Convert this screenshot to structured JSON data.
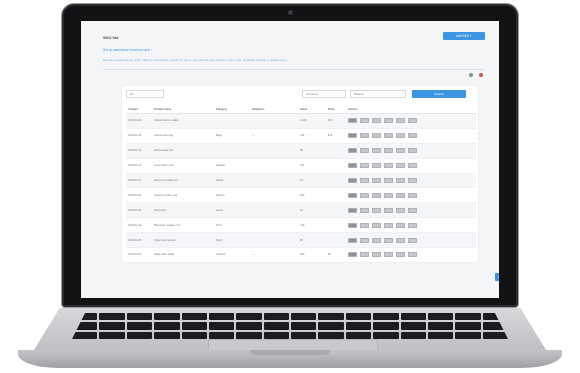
{
  "app": {
    "title": "SKU list",
    "primary_button": "Add SKU +",
    "link_text": "Set up warehouse inventory sync ›",
    "description": "Manage stock-keeping units. Filter by warehouse, search by name, and use the row actions to view, edit, duplicate, archive or delete items.",
    "icons": [
      "settings-icon",
      "alert-icon"
    ],
    "filters": {
      "per_page": "10",
      "status": "All status",
      "search_placeholder": "Search",
      "button": "Search"
    },
    "table": {
      "headers": [
        "Created",
        "Product name",
        "Category",
        "Variations",
        "Stock",
        "Price",
        "Actions"
      ],
      "rows": [
        [
          "2019-01-02",
          "Classic leather wallet",
          "",
          "",
          "1,204",
          "€12",
          ""
        ],
        [
          "2019-01-08",
          "Canvas tote bag",
          "Bags",
          "—",
          "312",
          "€15",
          ""
        ],
        [
          "2019-01-12",
          "Wool beanie hat",
          "",
          "",
          "98",
          "",
          ""
        ],
        [
          "2019-01-20",
          "Linen button shirt",
          "Apparel",
          "",
          "441",
          "",
          ""
        ],
        [
          "2019-02-01",
          "Running sneaker pro",
          "Shoes",
          "",
          "76",
          "",
          ""
        ],
        [
          "2019-02-06",
          "Ceramic coffee mug",
          "Kitchen",
          "",
          "530",
          "",
          ""
        ],
        [
          "2019-02-14",
          "Desk lamp",
          "Home",
          "",
          "22",
          "",
          ""
        ],
        [
          "2019-02-19",
          "Bluetooth speaker mini",
          "Tech",
          "",
          "140",
          "",
          ""
        ],
        [
          "2019-02-25",
          "Yoga mat premium",
          "Sport",
          "",
          "65",
          "",
          ""
        ],
        [
          "2019-03-01",
          "Steel water bottle",
          "Outdoor",
          "—",
          "300",
          "€9",
          ""
        ]
      ]
    },
    "pager": {
      "current": "1",
      "next": "›"
    },
    "colors": {
      "accent": "#3b95e3",
      "alert": "#d9534f",
      "bezel": "#111214",
      "body": "#c4c5c8"
    }
  }
}
